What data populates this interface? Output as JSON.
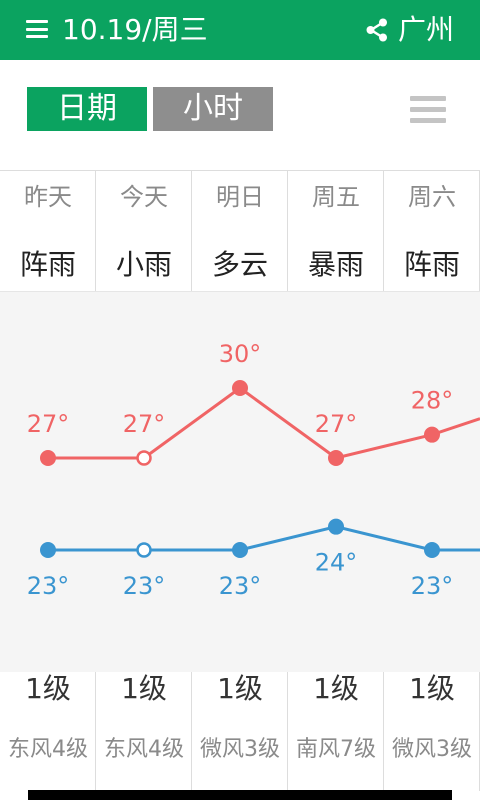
{
  "header": {
    "date_title": "10.19/周三",
    "city": "广州",
    "menu_icon": "menu-icon",
    "share_icon": "share-icon"
  },
  "tabs": [
    {
      "label": "日期",
      "active": true
    },
    {
      "label": "小时",
      "active": false
    }
  ],
  "list_icon": "list-icon",
  "colors": {
    "brand": "#0ba360",
    "inactive_tab": "#8e8e8e",
    "high_line": "#f06465",
    "low_line": "#3a95d0"
  },
  "days": [
    {
      "day": "昨天",
      "cond": "阵雨",
      "level": "1级",
      "wind": "东风4级"
    },
    {
      "day": "今天",
      "cond": "小雨",
      "level": "1级",
      "wind": "东风4级"
    },
    {
      "day": "明日",
      "cond": "多云",
      "level": "1级",
      "wind": "微风3级"
    },
    {
      "day": "周五",
      "cond": "暴雨",
      "level": "1级",
      "wind": "南风7级"
    },
    {
      "day": "周六",
      "cond": "阵雨",
      "level": "1级",
      "wind": "微风3级"
    }
  ],
  "chart_data": {
    "type": "line",
    "categories": [
      "昨天",
      "今天",
      "明日",
      "周五",
      "周六"
    ],
    "series": [
      {
        "values": [
          27,
          27,
          30,
          27,
          28
        ],
        "labels": [
          "27°",
          "27°",
          "30°",
          "27°",
          "28°"
        ]
      },
      {
        "values": [
          23,
          23,
          23,
          24,
          23
        ],
        "labels": [
          "23°",
          "23°",
          "23°",
          "24°",
          "23°"
        ]
      }
    ],
    "highlight_index": 1
  }
}
